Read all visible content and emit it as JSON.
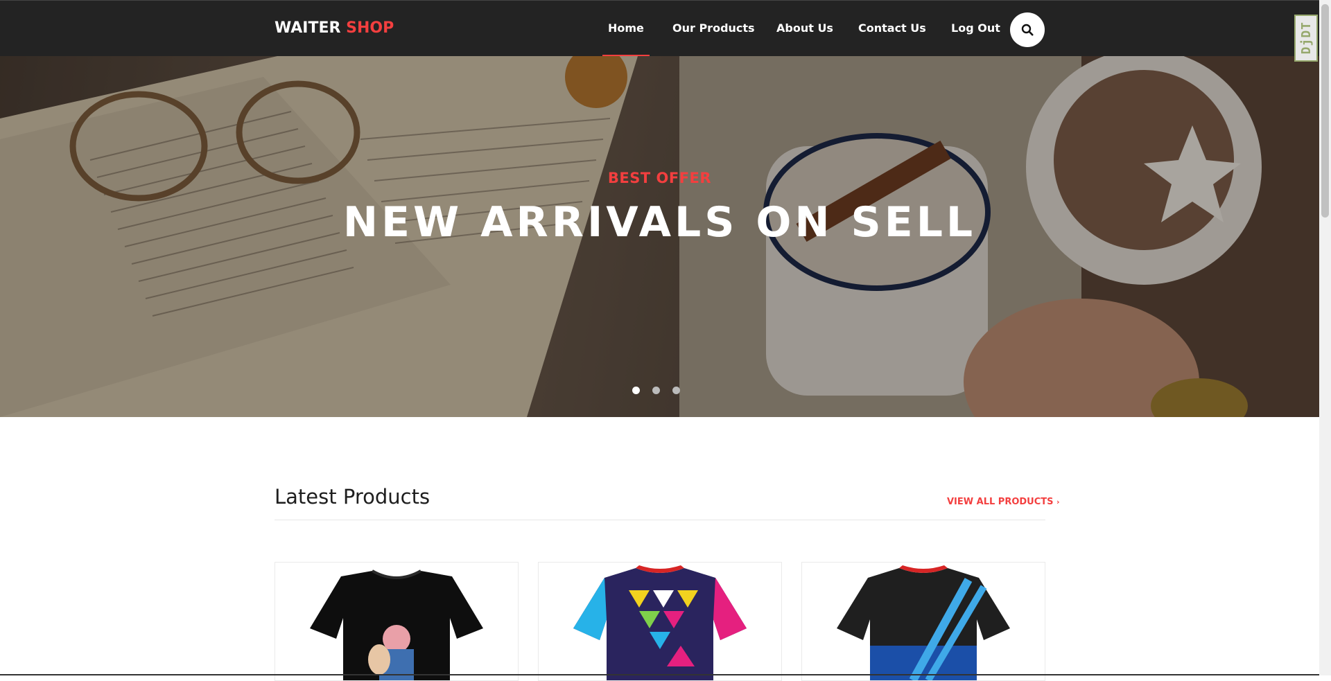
{
  "brand": {
    "part1": "WAITER",
    "part2": "SHOP",
    "accent_color": "#f33f3f"
  },
  "nav": {
    "items": [
      {
        "label": "Home",
        "active": true
      },
      {
        "label": "Our Products",
        "active": false
      },
      {
        "label": "About Us",
        "active": false
      },
      {
        "label": "Contact Us",
        "active": false
      },
      {
        "label": "Log Out",
        "active": false
      }
    ],
    "search_icon": "search-icon"
  },
  "debug_toolbar": {
    "label": "DjDT"
  },
  "hero": {
    "kicker": "BEST OFFER",
    "title": "NEW ARRIVALS ON SELL",
    "slides_count": 3,
    "active_slide": 1
  },
  "latest": {
    "title": "Latest Products",
    "view_all": "VIEW ALL PRODUCTS",
    "view_all_icon": "chevron-right-icon",
    "products": [
      {
        "image": "black graphic t-shirt"
      },
      {
        "image": "colorful triangle pattern jersey"
      },
      {
        "image": "black and blue sublimated jersey"
      }
    ]
  }
}
